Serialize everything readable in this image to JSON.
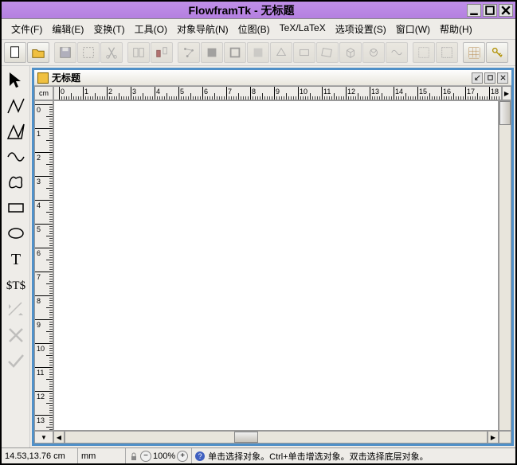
{
  "window": {
    "title": "FlowframTk - 无标题"
  },
  "menubar": {
    "items": [
      {
        "label": "文件(F)",
        "accel": "F"
      },
      {
        "label": "编辑(E)",
        "accel": "E"
      },
      {
        "label": "变换(T)",
        "accel": "T"
      },
      {
        "label": "工具(O)",
        "accel": "O"
      },
      {
        "label": "对象导航(N)",
        "accel": "N"
      },
      {
        "label": "位图(B)",
        "accel": "B"
      },
      {
        "label": "TeX/LaTeX",
        "accel": ""
      },
      {
        "label": "选项设置(S)",
        "accel": "S"
      },
      {
        "label": "窗口(W)",
        "accel": "W"
      },
      {
        "label": "帮助(H)",
        "accel": "H"
      }
    ]
  },
  "toolbar": {
    "new": "new-doc",
    "open": "open-doc",
    "save": "save-doc"
  },
  "sidetools": {
    "items": [
      "select",
      "line",
      "polyline",
      "curve",
      "closed-curve",
      "rectangle",
      "ellipse",
      "text",
      "math-text",
      "gap",
      "gap",
      "move-disabled",
      "cross-disabled",
      "check-disabled"
    ]
  },
  "document": {
    "title": "无标题",
    "ruler_unit": "cm",
    "hruler_labels": [
      "0",
      "1",
      "2",
      "3",
      "4",
      "5",
      "6",
      "7",
      "8",
      "9",
      "10",
      "11",
      "12",
      "13",
      "14",
      "15",
      "16",
      "17",
      "18"
    ],
    "vruler_labels": [
      "0",
      "1",
      "2",
      "3",
      "4",
      "5",
      "6",
      "7",
      "8",
      "9",
      "10",
      "11",
      "12",
      "13"
    ]
  },
  "status": {
    "coords": "14.53,13.76 cm",
    "unit": "mm",
    "zoom": "100%",
    "help": "单击选择对象。Ctrl+单击增选对象。双击选择底层对象。"
  }
}
